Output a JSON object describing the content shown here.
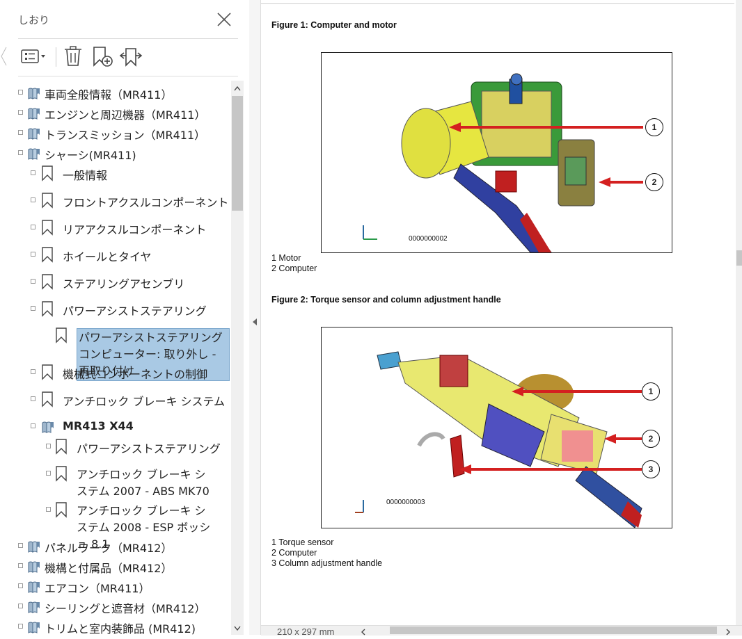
{
  "panel": {
    "title": "しおり",
    "toolbar": {
      "options_icon": "list-options-icon",
      "delete_icon": "trash-icon",
      "new_bookmark_icon": "add-bookmark-icon",
      "expand_icon": "expand-bookmark-icon"
    },
    "tree": [
      {
        "label": "車両全般情報（MR411）",
        "level": 0,
        "kind": "book"
      },
      {
        "label": "エンジンと周辺機器（MR411）",
        "level": 0,
        "kind": "book"
      },
      {
        "label": "トランスミッション（MR411）",
        "level": 0,
        "kind": "book"
      },
      {
        "label": "シャーシ(MR411)",
        "level": 0,
        "kind": "book"
      },
      {
        "label": "一般情報",
        "level": 1,
        "kind": "bookmark"
      },
      {
        "label": "フロントアクスルコンポーネント",
        "level": 1,
        "kind": "bookmark"
      },
      {
        "label": "リアアクスルコンポーネント",
        "level": 1,
        "kind": "bookmark"
      },
      {
        "label": "ホイールとタイヤ",
        "level": 1,
        "kind": "bookmark"
      },
      {
        "label": "ステアリングアセンブリ",
        "level": 1,
        "kind": "bookmark"
      },
      {
        "label": "パワーアシストステアリング",
        "level": 1,
        "kind": "bookmark"
      },
      {
        "label": "パワーアシストステアリングコンピューター: 取り外し - 再取り付け",
        "level": 2,
        "kind": "bookmark",
        "selected": true
      },
      {
        "label": "機械式コンポーネントの制御",
        "level": 1,
        "kind": "bookmark"
      },
      {
        "label": "アンチロック ブレーキ システム",
        "level": 1,
        "kind": "bookmark"
      },
      {
        "label": "MR413 X44",
        "level": 1,
        "kind": "book",
        "bold": true
      },
      {
        "label": "パワーアシストステアリング",
        "level": 2,
        "kind": "bookmark"
      },
      {
        "label": "アンチロック ブレーキ システム 2007 - ABS MK70",
        "level": 2,
        "kind": "bookmark"
      },
      {
        "label": "アンチロック ブレーキ システム 2008 - ESP ボッシュ 8.1",
        "level": 2,
        "kind": "bookmark"
      },
      {
        "label": "パネルワーク（MR412）",
        "level": 0,
        "kind": "book"
      },
      {
        "label": "機構と付属品（MR412）",
        "level": 0,
        "kind": "book"
      },
      {
        "label": "エアコン（MR411）",
        "level": 0,
        "kind": "book"
      },
      {
        "label": "シーリングと遮音材（MR412）",
        "level": 0,
        "kind": "book"
      },
      {
        "label": "トリムと室内装飾品 (MR412)",
        "level": 0,
        "kind": "book"
      }
    ]
  },
  "document": {
    "figure1": {
      "title": "Figure 1: Computer and motor",
      "image_id": "0000000002",
      "callouts": [
        "1",
        "2"
      ],
      "captions": [
        "1 Motor",
        "2 Computer"
      ]
    },
    "figure2": {
      "title": "Figure 2: Torque sensor and column adjustment handle",
      "image_id": "0000000003",
      "callouts": [
        "1",
        "2",
        "3"
      ],
      "captions": [
        "1 Torque sensor",
        "2 Computer",
        "3 Column adjustment handle"
      ]
    }
  },
  "status": {
    "page_size": "210 x 297 mm"
  },
  "colors": {
    "selection": "#a9c9e4",
    "callout_arrow": "#d42020"
  }
}
